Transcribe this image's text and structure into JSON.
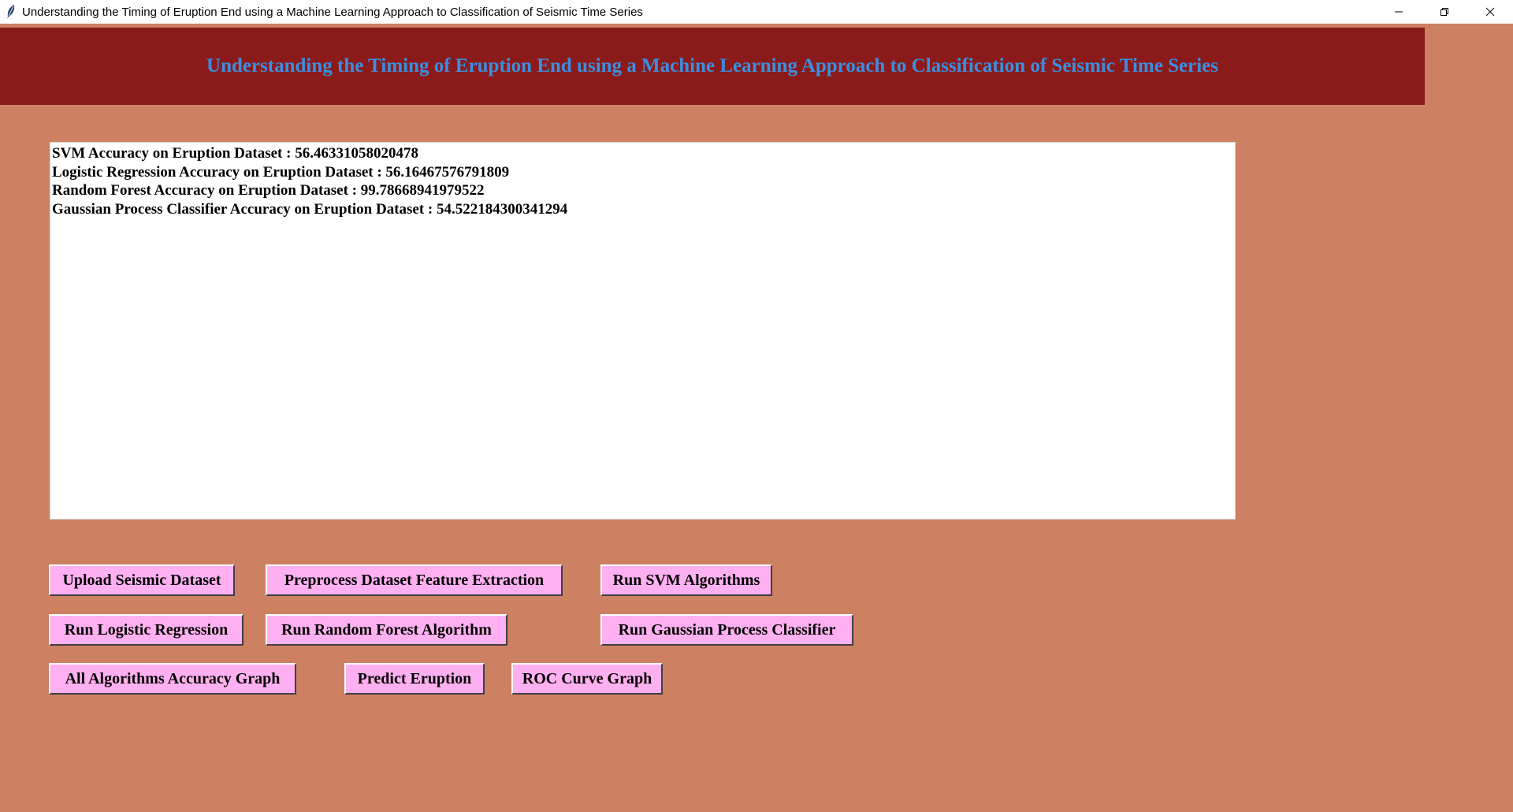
{
  "window": {
    "title": "Understanding the Timing of Eruption End using a Machine Learning Approach to Classification of Seismic Time Series"
  },
  "header": {
    "title": "Understanding the Timing of Eruption End using a Machine Learning Approach to Classification of Seismic Time Series"
  },
  "output": {
    "lines": [
      "SVM Accuracy on Eruption Dataset : 56.46331058020478",
      "Logistic Regression Accuracy on Eruption Dataset : 56.16467576791809",
      "Random Forest Accuracy on Eruption Dataset : 99.78668941979522",
      "Gaussian Process Classifier Accuracy on Eruption Dataset : 54.522184300341294"
    ]
  },
  "buttons": {
    "upload": "Upload Seismic Dataset",
    "preprocess": "Preprocess Dataset Feature Extraction",
    "run_svm": "Run SVM Algorithms",
    "run_logistic": "Run Logistic Regression",
    "run_random_forest": "Run Random Forest Algorithm",
    "run_gaussian": "Run Gaussian Process Classifier",
    "accuracy_graph": "All Algorithms Accuracy Graph",
    "predict": "Predict Eruption",
    "roc_graph": "ROC Curve Graph"
  },
  "colors": {
    "background": "#cd8062",
    "header_bg": "#8b1a1a",
    "header_text": "#3a8fe0",
    "button_bg": "#ffb0f0"
  }
}
